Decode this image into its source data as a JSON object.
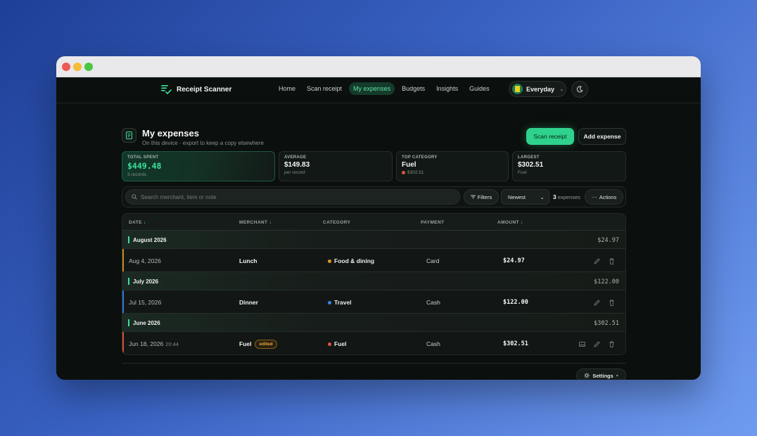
{
  "app": {
    "name": "Receipt Scanner"
  },
  "nav": {
    "links": [
      {
        "label": "Home",
        "active": false
      },
      {
        "label": "Scan receipt",
        "active": false
      },
      {
        "label": "My expenses",
        "active": true
      },
      {
        "label": "Budgets",
        "active": false
      },
      {
        "label": "Insights",
        "active": false
      },
      {
        "label": "Guides",
        "active": false
      }
    ],
    "workspace": "Everyday",
    "theme_icon": "moon-icon"
  },
  "page": {
    "title": "My expenses",
    "subtitle": "On this device · export to keep a copy elsewhere",
    "scan_label": "Scan receipt",
    "add_label": "Add expense"
  },
  "stats": {
    "total": {
      "label": "TOTAL SPENT",
      "value": "$449.48",
      "sub": "3 records"
    },
    "average": {
      "label": "AVERAGE",
      "value": "$149.83",
      "sub": "per record"
    },
    "top": {
      "label": "TOP CATEGORY",
      "value": "Fuel",
      "sub": "$302.51"
    },
    "largest": {
      "label": "LARGEST",
      "value": "$302.51",
      "sub": "Fuel"
    }
  },
  "toolbar": {
    "search_placeholder": "Search merchant, item or note",
    "filters_label": "Filters",
    "sort_value": "Newest",
    "count_number": "3",
    "count_label": "expenses",
    "actions_label": "Actions"
  },
  "table": {
    "headers": {
      "date": "DATE",
      "merchant": "MERCHANT",
      "category": "CATEGORY",
      "payment": "PAYMENT",
      "amount": "AMOUNT"
    },
    "groups": [
      {
        "label": "August 2026",
        "total": "$24.97",
        "rows": [
          {
            "date": "Aug 4, 2026",
            "time": "",
            "merchant": "Lunch",
            "badge": "",
            "category": "Food & dining",
            "category_color": "#e3951f",
            "payment": "Card",
            "amount": "$24.97",
            "accent": "#c98a1e"
          }
        ]
      },
      {
        "label": "July 2026",
        "total": "$122.00",
        "rows": [
          {
            "date": "Jul 15, 2026",
            "time": "",
            "merchant": "Dinner",
            "badge": "",
            "category": "Travel",
            "category_color": "#3a86e0",
            "payment": "Cash",
            "amount": "$122.00",
            "accent": "#2f78d6"
          }
        ]
      },
      {
        "label": "June 2026",
        "total": "$302.51",
        "rows": [
          {
            "date": "Jun 18, 2026",
            "time": "20:44",
            "merchant": "Fuel",
            "badge": "edited",
            "category": "Fuel",
            "category_color": "#e2533e",
            "payment": "Cash",
            "amount": "$302.51",
            "accent": "#d4513b"
          }
        ]
      }
    ]
  },
  "footer": {
    "settings_label": "Settings"
  },
  "colors": {
    "accent": "#2fd28d",
    "background": "#0b0f0d"
  }
}
